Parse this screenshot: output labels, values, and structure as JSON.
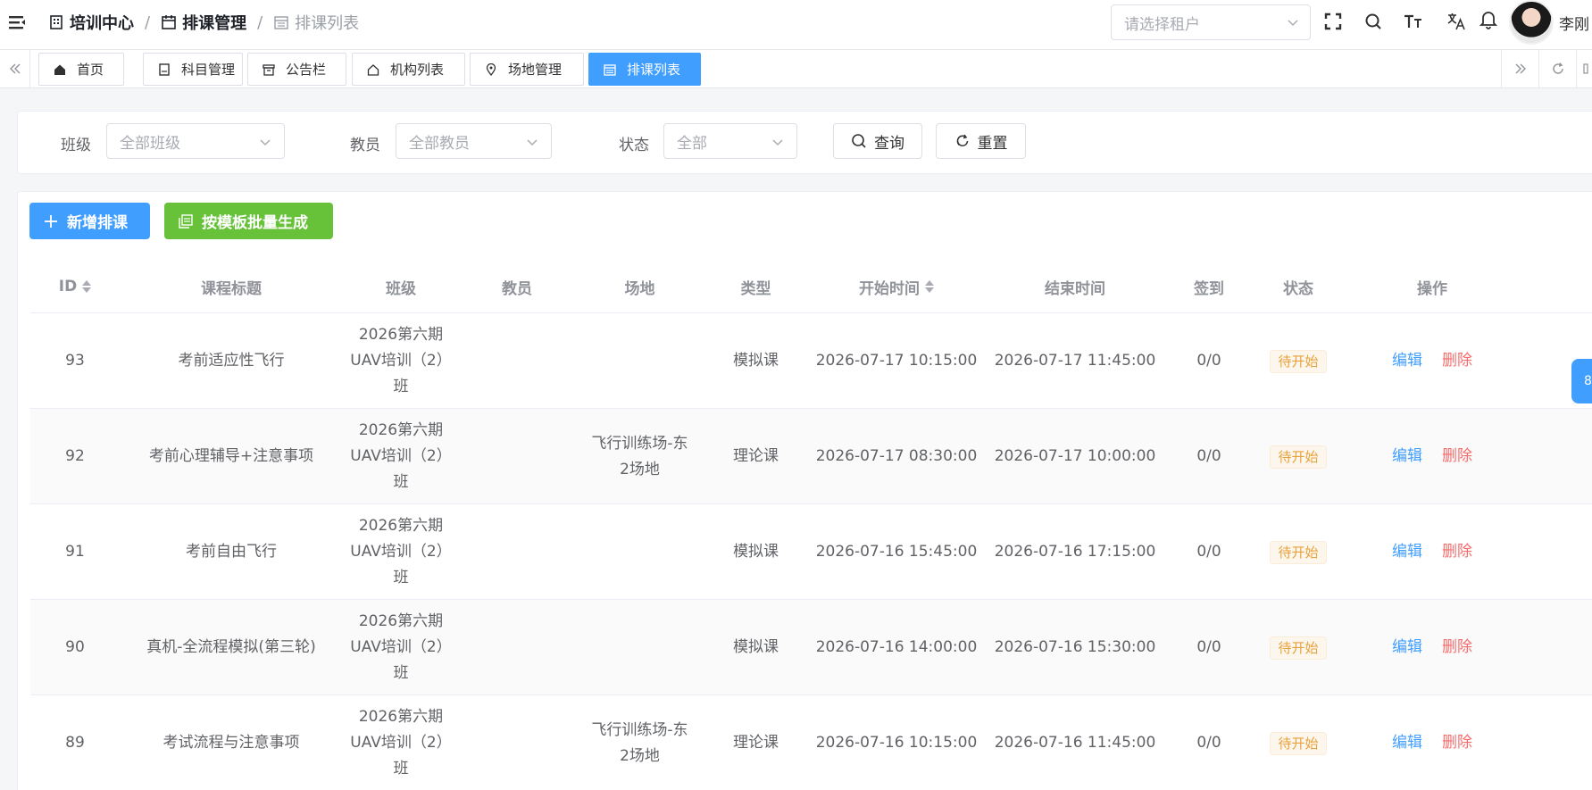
{
  "header": {
    "breadcrumb": {
      "level1": "培训中心",
      "level2": "排课管理",
      "level3": "排课列表",
      "separator": "/"
    },
    "tenant_placeholder": "请选择租户",
    "username": "李刚"
  },
  "tabs": [
    {
      "label": "首页",
      "icon": "home-icon"
    },
    {
      "label": "科目管理",
      "icon": "book-icon"
    },
    {
      "label": "公告栏",
      "icon": "archive-icon"
    },
    {
      "label": "机构列表",
      "icon": "house-icon"
    },
    {
      "label": "场地管理",
      "icon": "location-icon"
    },
    {
      "label": "排课列表",
      "icon": "calendar-icon",
      "active": true
    }
  ],
  "filters": {
    "class_label": "班级",
    "class_placeholder": "全部班级",
    "teacher_label": "教员",
    "teacher_placeholder": "全部教员",
    "status_label": "状态",
    "status_placeholder": "全部",
    "query_label": "查询",
    "reset_label": "重置"
  },
  "toolbar": {
    "add_label": "新增排课",
    "batch_label": "按模板批量生成"
  },
  "table": {
    "columns": [
      "ID",
      "课程标题",
      "班级",
      "教员",
      "场地",
      "类型",
      "开始时间",
      "结束时间",
      "签到",
      "状态",
      "操作"
    ],
    "edit_label": "编辑",
    "delete_label": "删除",
    "rows": [
      {
        "id": "93",
        "title": "考前适应性飞行",
        "class_line1": "2026第六期",
        "class_line2": "UAV培训（2）",
        "class_line3": "班",
        "teacher": "",
        "venue_line1": "",
        "venue_line2": "",
        "type": "模拟课",
        "start": "2026-07-17 10:15:00",
        "end": "2026-07-17 11:45:00",
        "checkin": "0/0",
        "status": "待开始"
      },
      {
        "id": "92",
        "title": "考前心理辅导+注意事项",
        "class_line1": "2026第六期",
        "class_line2": "UAV培训（2）",
        "class_line3": "班",
        "teacher": "",
        "venue_line1": "飞行训练场-东",
        "venue_line2": "2场地",
        "type": "理论课",
        "start": "2026-07-17 08:30:00",
        "end": "2026-07-17 10:00:00",
        "checkin": "0/0",
        "status": "待开始"
      },
      {
        "id": "91",
        "title": "考前自由飞行",
        "class_line1": "2026第六期",
        "class_line2": "UAV培训（2）",
        "class_line3": "班",
        "teacher": "",
        "venue_line1": "",
        "venue_line2": "",
        "type": "模拟课",
        "start": "2026-07-16 15:45:00",
        "end": "2026-07-16 17:15:00",
        "checkin": "0/0",
        "status": "待开始"
      },
      {
        "id": "90",
        "title": "真机-全流程模拟(第三轮)",
        "class_line1": "2026第六期",
        "class_line2": "UAV培训（2）",
        "class_line3": "班",
        "teacher": "",
        "venue_line1": "",
        "venue_line2": "",
        "type": "模拟课",
        "start": "2026-07-16 14:00:00",
        "end": "2026-07-16 15:30:00",
        "checkin": "0/0",
        "status": "待开始"
      },
      {
        "id": "89",
        "title": "考试流程与注意事项",
        "class_line1": "2026第六期",
        "class_line2": "UAV培训（2）",
        "class_line3": "班",
        "teacher": "",
        "venue_line1": "飞行训练场-东",
        "venue_line2": "2场地",
        "type": "理论课",
        "start": "2026-07-16 10:15:00",
        "end": "2026-07-16 11:45:00",
        "checkin": "0/0",
        "status": "待开始"
      }
    ]
  },
  "colors": {
    "primary": "#409eff",
    "success": "#67c23a",
    "danger": "#f56c6c",
    "warning": "#e6a23c"
  }
}
